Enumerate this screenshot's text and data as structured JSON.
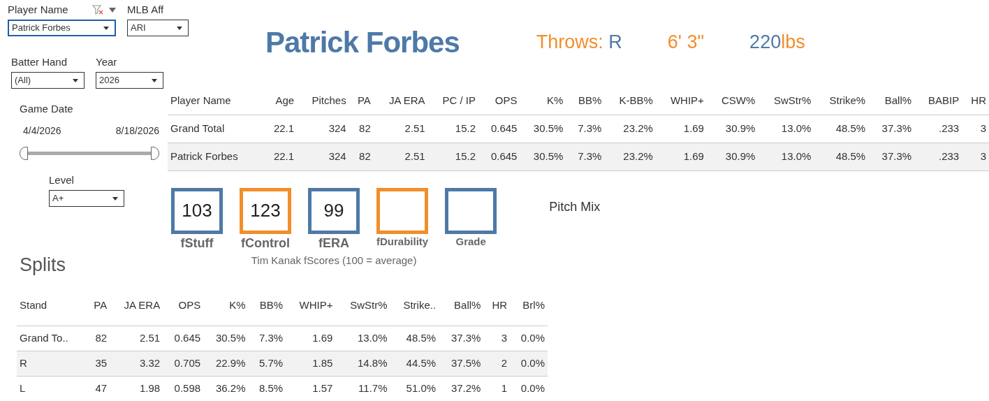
{
  "filters": [
    {
      "label": "Player Name",
      "value": "Patrick Forbes",
      "focused": true
    },
    {
      "label": "MLB Aff",
      "value": "ARI",
      "focused": false
    },
    {
      "label": "Batter Hand",
      "value": "(All)",
      "focused": false
    },
    {
      "label": "Year",
      "value": "2026",
      "focused": false
    }
  ],
  "game_date": {
    "label": "Game Date",
    "start": "4/4/2026",
    "end": "8/18/2026",
    "level": 1
  },
  "level_filter": {
    "label": "Level",
    "value": "A+"
  },
  "header": {
    "name": "Patrick Forbes",
    "stats": [
      [
        {
          "text": "Throws: ",
          "color": "#f28e2b"
        },
        {
          "text": "R",
          "color": "#4e79a7"
        }
      ],
      [
        {
          "text": "6' 3\"",
          "color": "#f28e2b"
        }
      ],
      [
        {
          "text": "220",
          "color": "#4e79a7"
        },
        {
          "text": "lbs",
          "color": "#f28e2b"
        }
      ]
    ]
  },
  "stats_table": {
    "columns": [
      "Player Name",
      "Age",
      "Pitches",
      "PA",
      "JA ERA",
      "PC / IP",
      "OPS",
      "K%",
      "BB%",
      "K-BB%",
      "WHIP+",
      "CSW%",
      "SwStr%",
      "Strike%",
      "Ball%",
      "BABIP",
      "HR"
    ],
    "rows": [
      [
        "Grand Total",
        "22.1",
        "324",
        "82",
        "2.51",
        "15.2",
        "0.645",
        "30.5%",
        "7.3%",
        "23.2%",
        "1.69",
        "30.9%",
        "13.0%",
        "48.5%",
        "37.3%",
        ".233",
        "3"
      ],
      [
        "Patrick Forbes",
        "22.1",
        "324",
        "82",
        "2.51",
        "15.2",
        "0.645",
        "30.5%",
        "7.3%",
        "23.2%",
        "1.69",
        "30.9%",
        "13.0%",
        "48.5%",
        "37.3%",
        ".233",
        "3"
      ]
    ]
  },
  "fscores": {
    "items": [
      {
        "value": "103",
        "label": "fStuff",
        "color": "#4e79a7"
      },
      {
        "value": "123",
        "label": "fControl",
        "color": "#f28e2b"
      },
      {
        "value": "99",
        "label": "fERA",
        "color": "#4e79a7"
      },
      {
        "label": "fDurability",
        "color": "#f28e2b"
      },
      {
        "label": "Grade",
        "color": "#4e79a7"
      }
    ],
    "caption": "Tim Kanak fScores (100 = average)"
  },
  "pitch_mix": {
    "title": "Pitch Mix"
  },
  "splits": {
    "title": "Splits",
    "columns": [
      "Stand",
      "PA",
      "JA ERA",
      "OPS",
      "K%",
      "BB%",
      "WHIP+",
      "SwStr%",
      "Strike..",
      "Ball%",
      "HR",
      "Brl%"
    ],
    "rows": [
      [
        "Grand To..",
        "82",
        "2.51",
        "0.645",
        "30.5%",
        "7.3%",
        "1.69",
        "13.0%",
        "48.5%",
        "37.3%",
        "3",
        "0.0%"
      ],
      [
        "R",
        "35",
        "3.32",
        "0.705",
        "22.9%",
        "5.7%",
        "1.85",
        "14.8%",
        "44.5%",
        "37.5%",
        "2",
        "0.0%"
      ],
      [
        "L",
        "47",
        "1.98",
        "0.598",
        "36.2%",
        "8.5%",
        "1.57",
        "11.7%",
        "51.0%",
        "37.2%",
        "1",
        "0.0%"
      ]
    ]
  }
}
